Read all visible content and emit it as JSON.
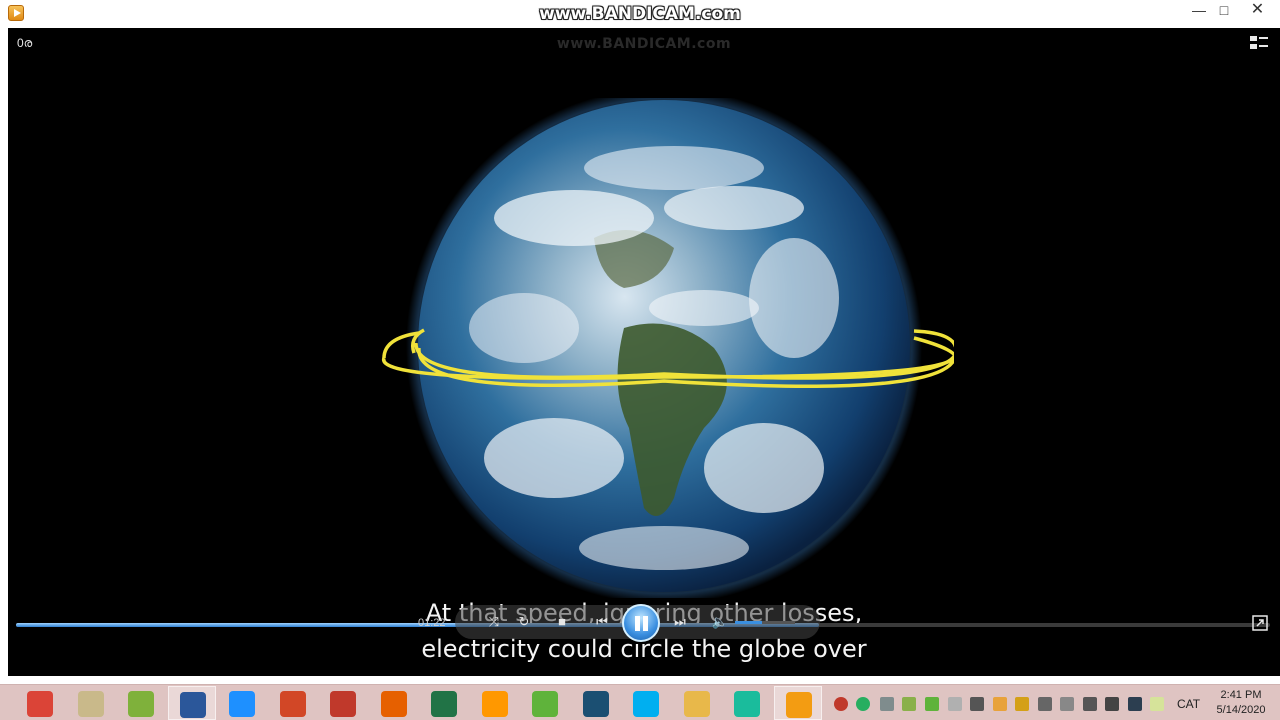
{
  "window": {
    "watermark": "www.BANDICAM.com",
    "minimize_glyph": "—",
    "maximize_glyph": "□",
    "close_glyph": "✕"
  },
  "video": {
    "corner_label": "0ര",
    "watermark": "www.BANDICAM.com",
    "progress_fraction": 0.64,
    "subtitle_line1": "At that speed, ignoring other losses,",
    "subtitle_line2": "electricity could circle the globe over"
  },
  "controls": {
    "time": "01:22",
    "shuffle_glyph": "⤨",
    "repeat_glyph": "↻",
    "stop_glyph": "■",
    "prev_glyph": "⏮",
    "next_glyph": "⏭",
    "volume_glyph": "🔈",
    "volume_fraction": 0.45,
    "accent": "#3a8fe0"
  },
  "taskbar": {
    "apps": [
      {
        "name": "chrome-icon",
        "color": "#db4437"
      },
      {
        "name": "notes-icon",
        "color": "#c9b98a"
      },
      {
        "name": "picasa-icon",
        "color": "#7fb13b"
      },
      {
        "name": "word-icon",
        "color": "#2b579a"
      },
      {
        "name": "internet-explorer-icon",
        "color": "#1e90ff"
      },
      {
        "name": "powerpoint-icon",
        "color": "#d24726"
      },
      {
        "name": "garena-icon",
        "color": "#c0392b"
      },
      {
        "name": "firefox-icon",
        "color": "#e66000"
      },
      {
        "name": "excel-icon",
        "color": "#217346"
      },
      {
        "name": "sublime-icon",
        "color": "#ff9800"
      },
      {
        "name": "utorrent-icon",
        "color": "#5fb33b"
      },
      {
        "name": "steam-icon",
        "color": "#1b4f72"
      },
      {
        "name": "skype-icon",
        "color": "#00aff0"
      },
      {
        "name": "file-explorer-icon",
        "color": "#e8b84a"
      },
      {
        "name": "filmora-icon",
        "color": "#1abc9c"
      },
      {
        "name": "media-player-icon",
        "color": "#f39c12"
      }
    ],
    "language": "CAT",
    "time": "2:41 PM",
    "date": "5/14/2020"
  }
}
